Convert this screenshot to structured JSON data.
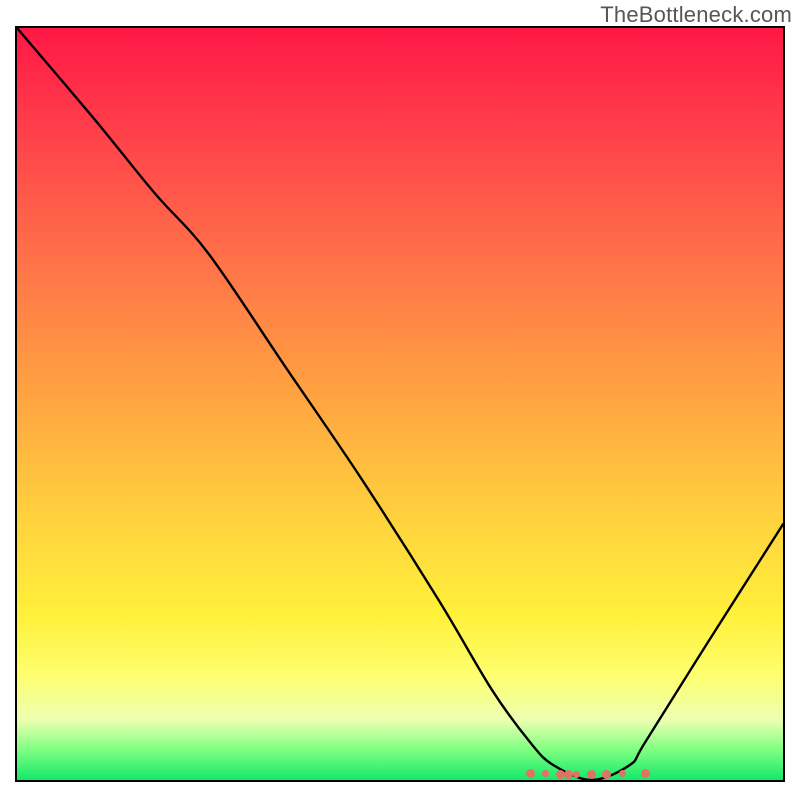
{
  "watermark": "TheBottleneck.com",
  "chart_data": {
    "type": "line",
    "title": "",
    "xlabel": "",
    "ylabel": "",
    "xlim": [
      0,
      100
    ],
    "ylim": [
      0,
      100
    ],
    "grid": false,
    "legend": false,
    "background": "rainbow-gradient",
    "series": [
      {
        "name": "bottleneck-curve",
        "color": "#000000",
        "x": [
          0,
          10,
          18,
          25,
          35,
          45,
          55,
          62,
          67,
          70,
          75,
          80,
          82,
          90,
          100
        ],
        "values": [
          100,
          88,
          78,
          70,
          55,
          40,
          24,
          12,
          5,
          2,
          0,
          2,
          5,
          18,
          34
        ]
      }
    ],
    "scatter": {
      "name": "highlight-points",
      "color": "#e37262",
      "x": [
        67,
        69,
        71,
        72,
        73,
        75,
        77,
        79,
        82
      ],
      "values": [
        0.8,
        0.8,
        0.7,
        0.7,
        0.7,
        0.7,
        0.7,
        0.8,
        0.9
      ]
    }
  }
}
